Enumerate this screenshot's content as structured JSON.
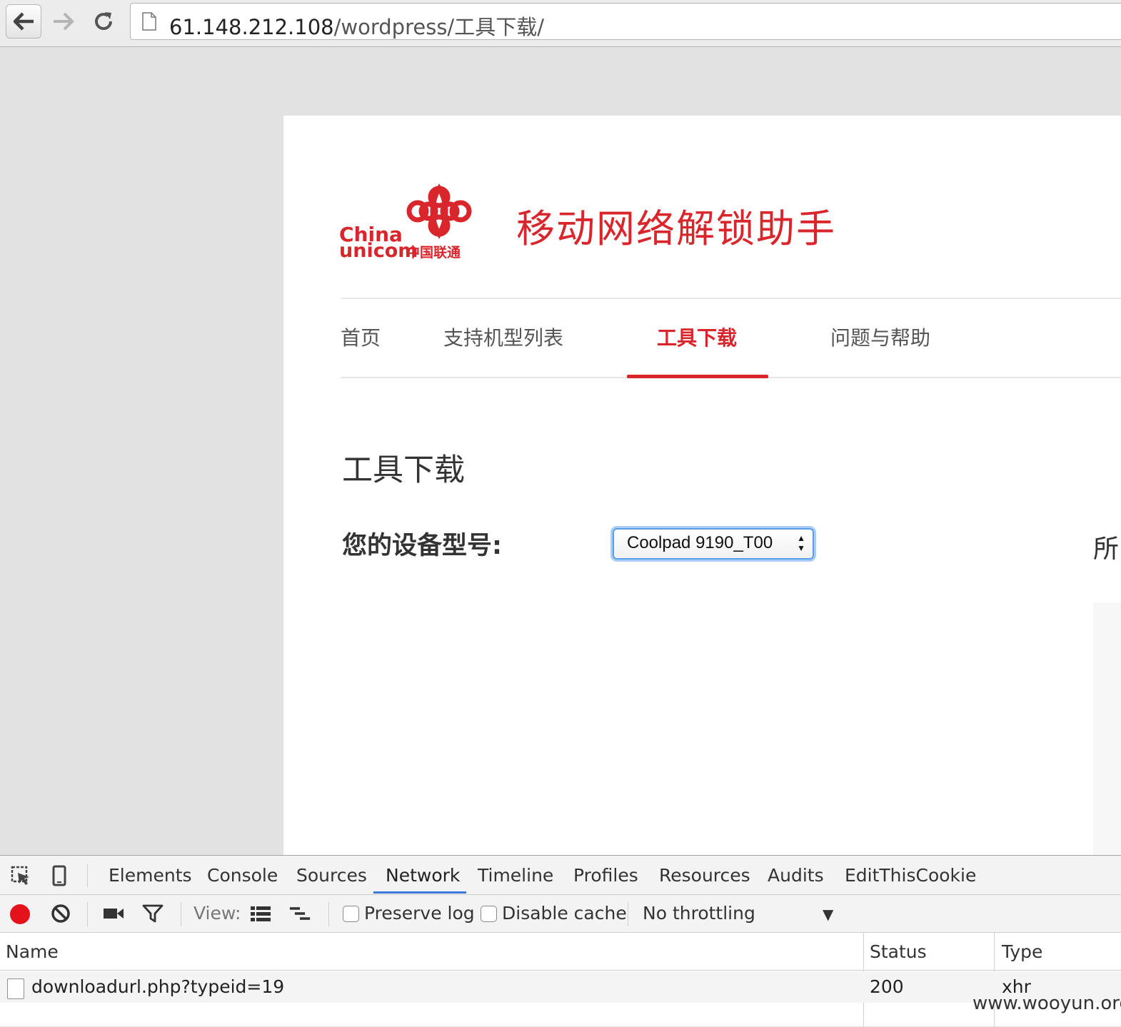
{
  "browser": {
    "url_host": "61.148.212.108",
    "url_path": "/wordpress/工具下载/",
    "back_icon": "arrow-left-icon",
    "forward_icon": "arrow-right-icon",
    "reload_icon": "reload-icon"
  },
  "site": {
    "logo_text_line1": "China",
    "logo_text_line2": "unicom",
    "logo_text_cn": "中国联通",
    "title": "移动网络解锁助手",
    "brand_color": "#d9262c",
    "nav": [
      {
        "label": "首页"
      },
      {
        "label": "支持机型列表"
      },
      {
        "label": "工具下载",
        "active": true
      },
      {
        "label": "问题与帮助"
      }
    ]
  },
  "main": {
    "section_title": "工具下载",
    "device_label": "您的设备型号:",
    "device_selected": "Coolpad 9190_T00",
    "right_fragment": "所"
  },
  "devtools": {
    "tabs": [
      "Elements",
      "Console",
      "Sources",
      "Network",
      "Timeline",
      "Profiles",
      "Resources",
      "Audits",
      "EditThisCookie"
    ],
    "active_tab": "Network",
    "view_label": "View:",
    "preserve_log": "Preserve log",
    "disable_cache": "Disable cache",
    "throttling": "No throttling",
    "columns": [
      "Name",
      "Status",
      "Type"
    ],
    "rows": [
      {
        "name": "downloadurl.php?typeid=19",
        "status": "200",
        "type": "xhr"
      }
    ],
    "record_color": "#e4121b",
    "accent": "#3879d9"
  },
  "watermark": "www.wooyun.org"
}
